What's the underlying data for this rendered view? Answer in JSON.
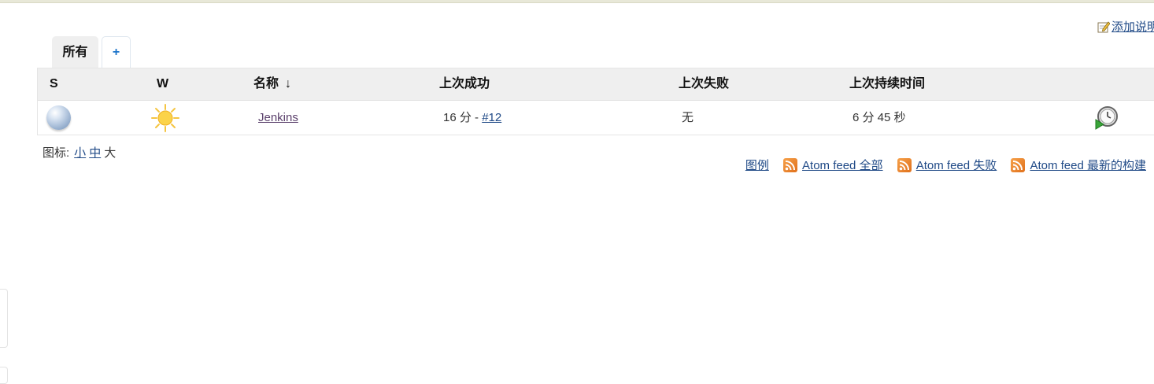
{
  "header": {
    "add_description_label": "添加说明"
  },
  "tabs": [
    {
      "label": "所有"
    },
    {
      "label": "+"
    }
  ],
  "table": {
    "columns": {
      "status": "S",
      "weather": "W",
      "name": "名称",
      "name_sort_arrow": "↓",
      "last_success": "上次成功",
      "last_failure": "上次失败",
      "last_duration": "上次持续时间"
    },
    "rows": [
      {
        "status_icon": "blue-ball-icon",
        "weather_icon": "sunny-icon",
        "name": "Jenkins",
        "last_success_time": "16 分",
        "last_success_separator": " - ",
        "last_success_build": "#12",
        "last_failure": "无",
        "last_duration": "6 分 45 秒",
        "action_icon": "schedule-build-icon"
      }
    ]
  },
  "icon_size": {
    "label": "图标:",
    "small": "小",
    "medium": "中",
    "large": "大"
  },
  "footer_links": {
    "legend": "图例",
    "atom_all": "Atom feed 全部",
    "atom_failed": "Atom feed 失败",
    "atom_latest": "Atom feed 最新的构建"
  },
  "colors": {
    "link": "#204a87",
    "header_bg": "#efefef",
    "tab_add": "#1a73c9",
    "rss": "#e0701b"
  }
}
